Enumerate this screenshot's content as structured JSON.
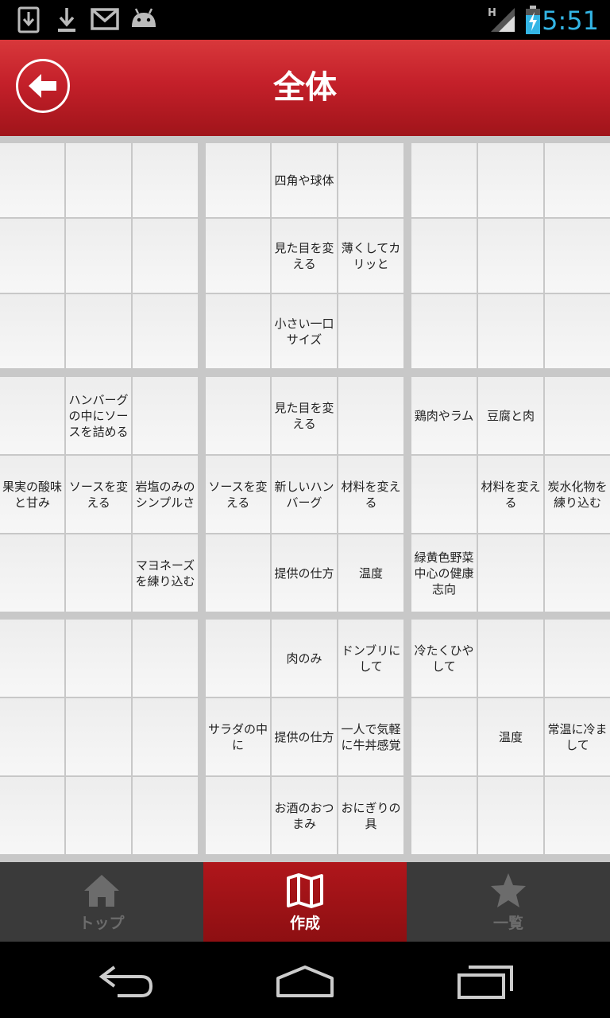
{
  "status_bar": {
    "time": "5:51",
    "icons": [
      "download-notification-icon",
      "download-icon",
      "gmail-icon",
      "android-debug-icon",
      "signal-h-icon",
      "battery-charging-icon"
    ]
  },
  "app_bar": {
    "title": "全体",
    "back_icon": "arrow-left-icon"
  },
  "grid": {
    "cells": [
      [
        "",
        "",
        "",
        "",
        "四角や球体",
        "",
        "",
        "",
        ""
      ],
      [
        "",
        "",
        "",
        "",
        "見た目を変える",
        "薄くしてカリッと",
        "",
        "",
        ""
      ],
      [
        "",
        "",
        "",
        "",
        "小さい一口サイズ",
        "",
        "",
        "",
        ""
      ],
      [
        "",
        "ハンバーグの中にソースを詰める",
        "",
        "",
        "見た目を変える",
        "",
        "鶏肉やラム",
        "豆腐と肉",
        ""
      ],
      [
        "果実の酸味と甘み",
        "ソースを変える",
        "岩塩のみのシンプルさ",
        "ソースを変える",
        "新しいハンバーグ",
        "材料を変える",
        "",
        "材料を変える",
        "炭水化物を練り込む"
      ],
      [
        "",
        "",
        "マヨネーズを練り込む",
        "",
        "提供の仕方",
        "温度",
        "緑黄色野菜中心の健康志向",
        "",
        ""
      ],
      [
        "",
        "",
        "",
        "",
        "肉のみ",
        "ドンブリにして",
        "冷たくひやして",
        "",
        ""
      ],
      [
        "",
        "",
        "",
        "サラダの中に",
        "提供の仕方",
        "一人で気軽に牛丼感覚",
        "",
        "温度",
        "常温に冷まして"
      ],
      [
        "",
        "",
        "",
        "",
        "お酒のおつまみ",
        "おにぎりの具",
        "",
        "",
        ""
      ]
    ]
  },
  "tab_bar": {
    "tabs": [
      {
        "label": "トップ",
        "icon": "home-icon",
        "active": false
      },
      {
        "label": "作成",
        "icon": "map-icon",
        "active": true
      },
      {
        "label": "一覧",
        "icon": "star-icon",
        "active": false
      }
    ]
  },
  "nav_bar": {
    "icons": [
      "back-nav-icon",
      "home-nav-icon",
      "recent-apps-icon"
    ]
  }
}
